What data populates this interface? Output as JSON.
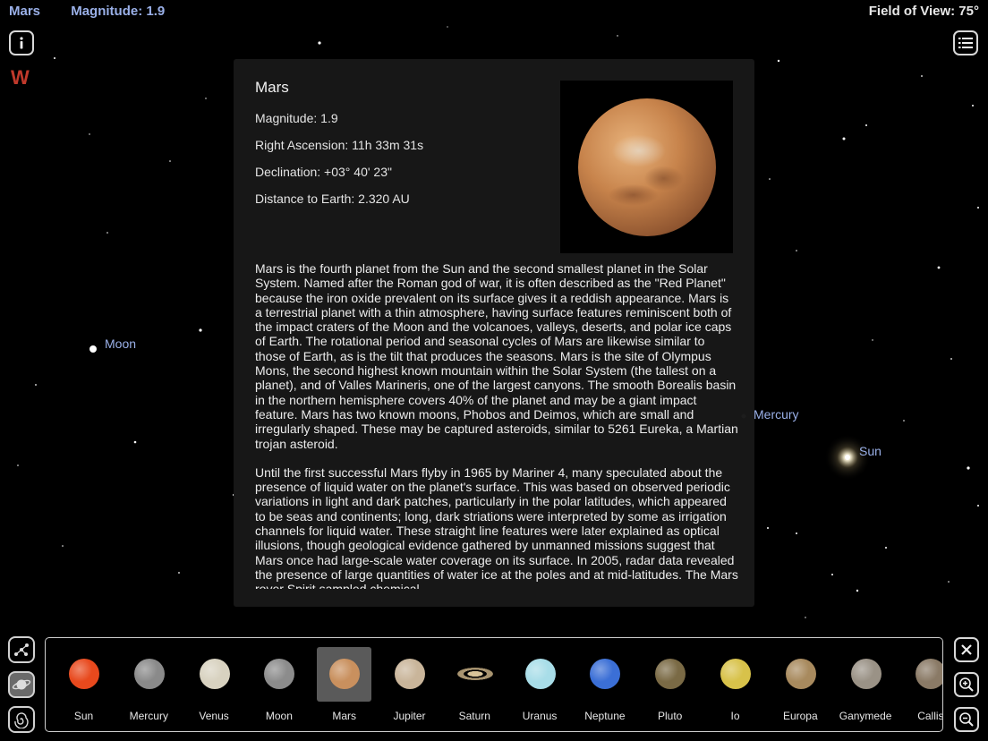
{
  "header": {
    "object_name": "Mars",
    "magnitude": "Magnitude: 1.9",
    "field_of_view": "Field of View: 75°"
  },
  "compass": {
    "direction": "W",
    "color": "#c0392b"
  },
  "sky_labels": {
    "moon": "Moon",
    "mercury": "Mercury",
    "sun": "Sun"
  },
  "panel": {
    "title": "Mars",
    "magnitude": "Magnitude: 1.9",
    "right_ascension": "Right Ascension: 11h 33m 31s",
    "declination": "Declination: +03° 40' 23\"",
    "distance": "Distance to Earth: 2.320 AU",
    "paragraphs": [
      "Mars is the fourth planet from the Sun and the second smallest planet in the Solar System. Named after the Roman god of war, it is often described as the \"Red Planet\" because the iron oxide prevalent on its surface gives it a reddish appearance. Mars is a terrestrial planet with a thin atmosphere, having surface features reminiscent both of the impact craters of the Moon and the volcanoes, valleys, deserts, and polar ice caps of Earth. The rotational period and seasonal cycles of Mars are likewise similar to those of Earth, as is the tilt that produces the seasons. Mars is the site of Olympus Mons, the second highest known mountain within the Solar System (the tallest on a planet), and of Valles Marineris, one of the largest canyons. The smooth Borealis basin in the northern hemisphere covers 40% of the planet and may be a giant impact feature. Mars has two known moons, Phobos and Deimos, which are small and irregularly shaped. These may be captured asteroids, similar to 5261 Eureka, a Martian trojan asteroid.",
      "Until the first successful Mars flyby in 1965 by Mariner 4, many speculated about the presence of liquid water on the planet's surface. This was based on observed periodic variations in light and dark patches, particularly in the polar latitudes, which appeared to be seas and continents; long, dark striations were interpreted by some as irrigation channels for liquid water. These straight line features were later explained as optical illusions, though geological evidence gathered by unmanned missions suggest that Mars once had large-scale water coverage on its surface. In 2005, radar data revealed the presence of large quantities of water ice at the poles and at mid-latitudes. The Mars rover Spirit sampled chemical"
    ]
  },
  "icons": {
    "info": "info-icon",
    "menu": "list-icon",
    "constellation": "constellation-icon",
    "planet": "planet-icon",
    "galaxy": "galaxy-icon",
    "close": "close-icon",
    "zoom_in": "zoom-in-icon",
    "zoom_out": "zoom-out-icon"
  },
  "bodies": [
    {
      "name": "Sun",
      "color": "#e8491d"
    },
    {
      "name": "Mercury",
      "color": "#8a8a8a"
    },
    {
      "name": "Venus",
      "color": "#d8d2c0"
    },
    {
      "name": "Moon",
      "color": "#8c8c8c"
    },
    {
      "name": "Mars",
      "color": "#c9905e",
      "selected": true
    },
    {
      "name": "Jupiter",
      "color": "#c9b59a"
    },
    {
      "name": "Saturn",
      "color": "#c8b48a"
    },
    {
      "name": "Uranus",
      "color": "#a8dde8"
    },
    {
      "name": "Neptune",
      "color": "#3b6fd6"
    },
    {
      "name": "Pluto",
      "color": "#7a6a45"
    },
    {
      "name": "Io",
      "color": "#d8c24a"
    },
    {
      "name": "Europa",
      "color": "#a88a5e"
    },
    {
      "name": "Ganymede",
      "color": "#9a9286"
    },
    {
      "name": "Callis",
      "color": "#8a7a66"
    }
  ]
}
